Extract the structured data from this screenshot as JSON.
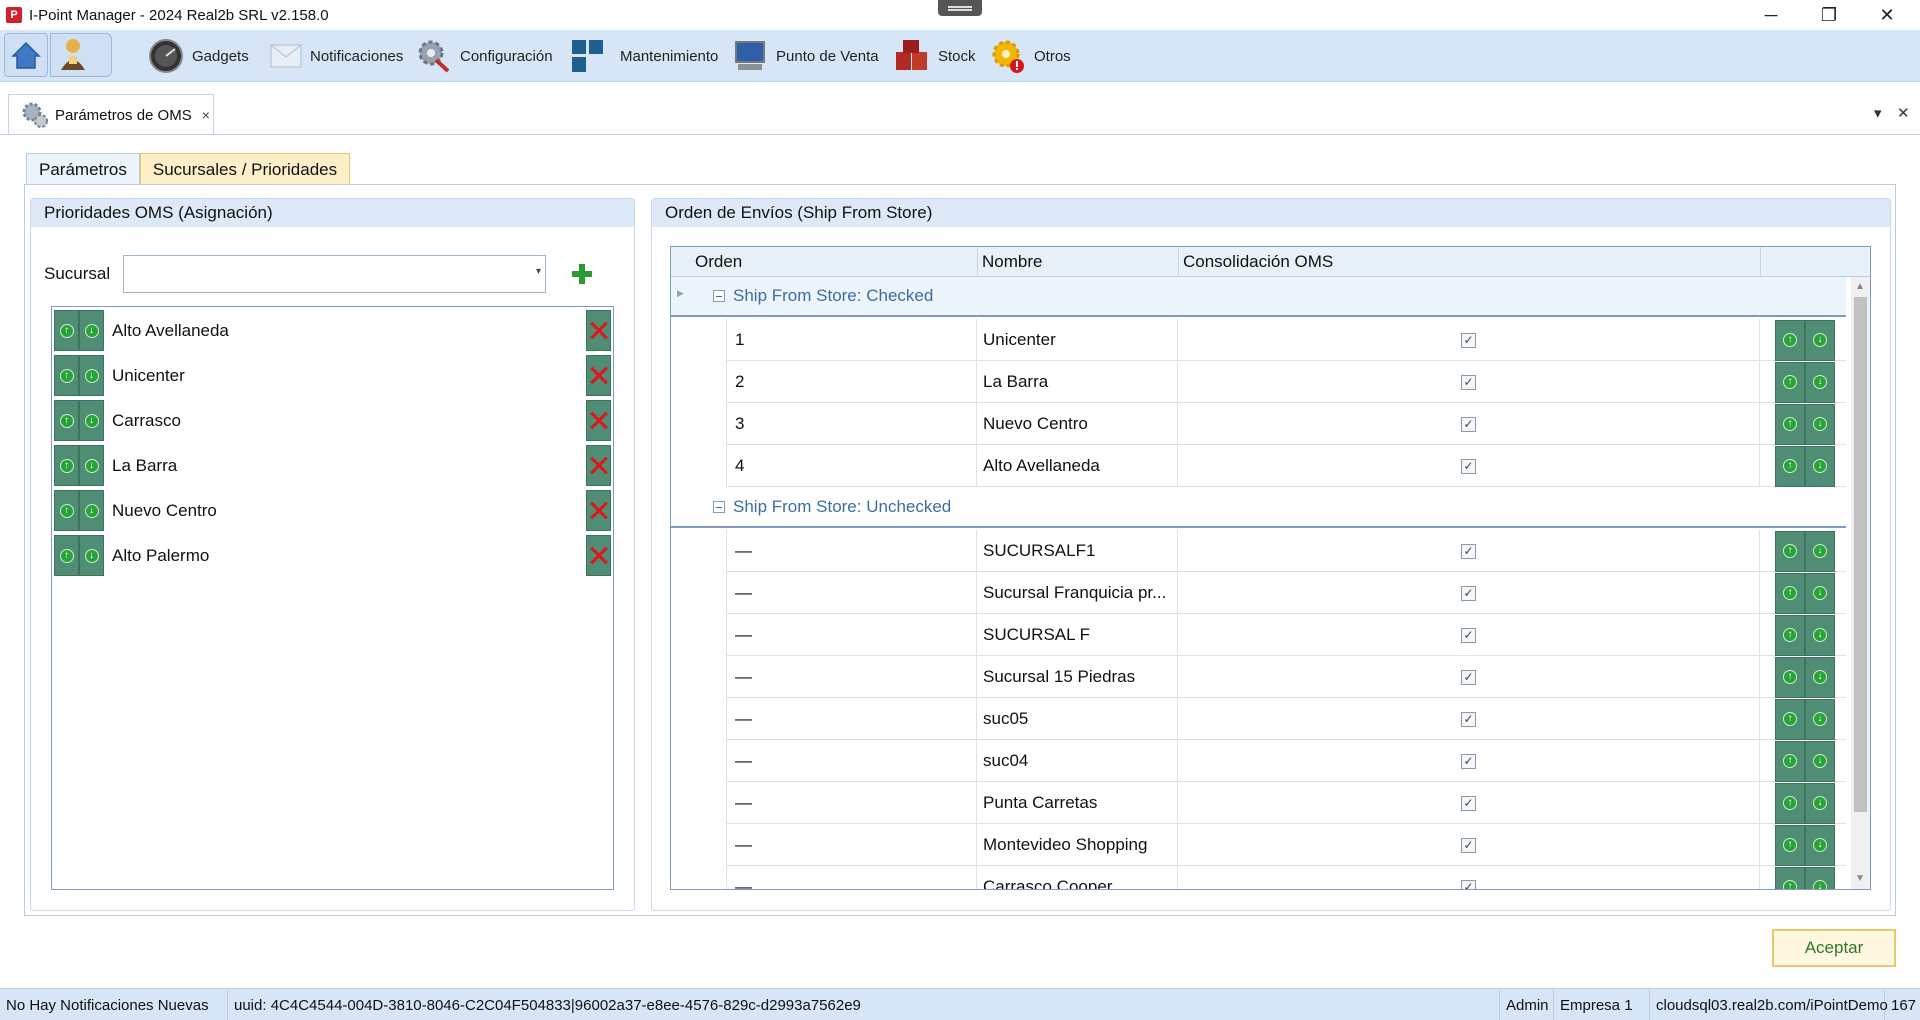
{
  "window": {
    "title": "I-Point Manager - 2024 Real2b SRL v2.158.0",
    "minimize": "─",
    "restore": "❐",
    "close": "✕"
  },
  "toolbar": {
    "items": [
      {
        "label": "Gadgets",
        "icon": "gauge-icon"
      },
      {
        "label": "Notificaciones",
        "icon": "envelope-icon"
      },
      {
        "label": "Configuración",
        "icon": "gear-wrench-icon"
      },
      {
        "label": "Mantenimiento",
        "icon": "blocks-icon"
      },
      {
        "label": "Punto de Venta",
        "icon": "monitor-icon"
      },
      {
        "label": "Stock",
        "icon": "boxes-icon"
      },
      {
        "label": "Otros",
        "icon": "gear-alert-icon"
      }
    ]
  },
  "doc_tab": {
    "label": "Parámetros de OMS",
    "close": "×"
  },
  "doc_controls": {
    "dropdown": "▾",
    "close": "✕"
  },
  "subtabs": [
    {
      "label": "Parámetros",
      "active": false
    },
    {
      "label": "Sucursales / Prioridades",
      "active": true
    }
  ],
  "left_group": {
    "title": "Prioridades OMS (Asignación)",
    "sucursal_label": "Sucursal",
    "sucursal_value": "",
    "combo_arrow": "▾",
    "items": [
      "Alto Avellaneda",
      "Unicenter",
      "Carrasco",
      "La Barra",
      "Nuevo Centro",
      "Alto Palermo"
    ]
  },
  "right_group": {
    "title": "Orden de Envíos (Ship From Store)",
    "columns": [
      "Orden",
      "Nombre",
      "Consolidación OMS"
    ],
    "groups": [
      {
        "label": "Ship From Store: Checked",
        "rows": [
          {
            "order": "1",
            "name": "Unicenter",
            "checked": true
          },
          {
            "order": "2",
            "name": "La Barra",
            "checked": true
          },
          {
            "order": "3",
            "name": "Nuevo Centro",
            "checked": true
          },
          {
            "order": "4",
            "name": "Alto Avellaneda",
            "checked": true
          }
        ]
      },
      {
        "label": "Ship From Store: Unchecked",
        "rows": [
          {
            "order": "—",
            "name": "SUCURSALF1",
            "checked": true
          },
          {
            "order": "—",
            "name": "Sucursal Franquicia pr...",
            "checked": true
          },
          {
            "order": "—",
            "name": "SUCURSAL F",
            "checked": true
          },
          {
            "order": "—",
            "name": "Sucursal 15 Piedras",
            "checked": true
          },
          {
            "order": "—",
            "name": "suc05",
            "checked": true
          },
          {
            "order": "—",
            "name": "suc04",
            "checked": true
          },
          {
            "order": "—",
            "name": "Punta Carretas",
            "checked": true
          },
          {
            "order": "—",
            "name": "Montevideo Shopping",
            "checked": true
          },
          {
            "order": "—",
            "name": "Carrasco Cooper",
            "checked": true
          }
        ]
      }
    ]
  },
  "accept_label": "Aceptar",
  "statusbar": {
    "notifications": "No Hay Notificaciones Nuevas",
    "uuid": "uuid: 4C4C4544-004D-3810-8046-C2C04F504833|96002a37-e8ee-4576-829c-d2993a7562e9",
    "user": "Admin",
    "company": "Empresa 1",
    "server": "cloudsql03.real2b.com/iPointDemo",
    "code": "167"
  },
  "colors": {
    "toolbar": "#d6e6f7",
    "accent": "#e5c66b",
    "green": "#29a339",
    "red": "#e0141a"
  }
}
